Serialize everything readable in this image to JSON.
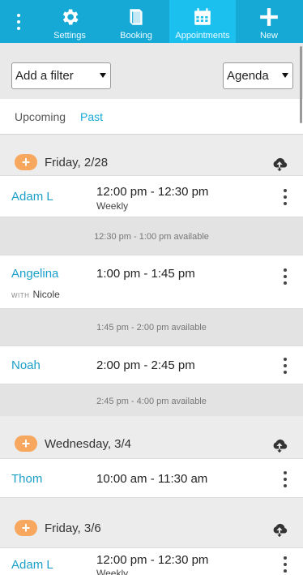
{
  "nav": {
    "items": [
      {
        "label": "Settings",
        "icon": "gear-icon"
      },
      {
        "label": "Booking",
        "icon": "book-icon"
      },
      {
        "label": "Appointments",
        "icon": "calendar-icon",
        "active": true
      },
      {
        "label": "New",
        "icon": "plus-icon"
      }
    ],
    "accent": "#16a9d5"
  },
  "filters": {
    "filter_label": "Add a filter",
    "view_label": "Agenda"
  },
  "tabs": {
    "upcoming": "Upcoming",
    "past": "Past",
    "active": "past"
  },
  "days": [
    {
      "label": "Friday, 2/28",
      "appointments": [
        {
          "name": "Adam L",
          "time": "12:00 pm - 12:30 pm",
          "sub": "Weekly"
        },
        {
          "available": "12:30 pm - 1:00 pm available"
        },
        {
          "name": "Angelina",
          "time": "1:00 pm - 1:45 pm",
          "with_prefix": "WITH",
          "with_name": "Nicole"
        },
        {
          "available": "1:45 pm - 2:00 pm available"
        },
        {
          "name": "Noah",
          "time": "2:00 pm - 2:45 pm"
        },
        {
          "available": "2:45 pm - 4:00 pm available"
        }
      ]
    },
    {
      "label": "Wednesday, 3/4",
      "appointments": [
        {
          "name": "Thom",
          "time": "10:00 am - 11:30 am"
        }
      ]
    },
    {
      "label": "Friday, 3/6",
      "appointments": [
        {
          "name": "Adam L",
          "time": "12:00 pm - 12:30 pm",
          "sub": "Weekly"
        }
      ]
    }
  ]
}
